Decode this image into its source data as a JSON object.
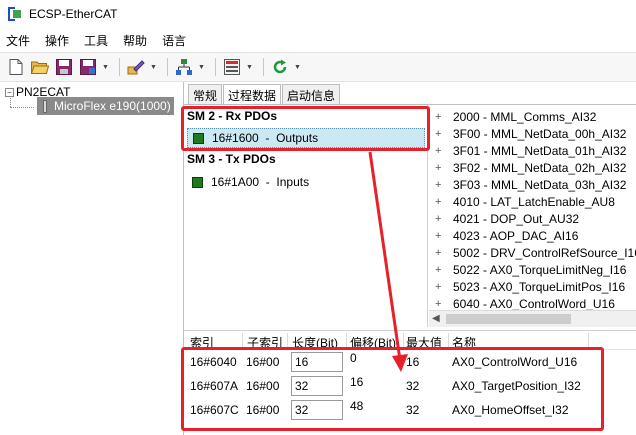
{
  "window": {
    "title": "ECSP-EtherCAT"
  },
  "menu": [
    "文件",
    "操作",
    "工具",
    "帮助",
    "语言"
  ],
  "toolbar": {
    "icons": [
      "new-file-icon",
      "open-folder-icon",
      "save-icon",
      "save-as-icon",
      "edit-icon",
      "network-icon",
      "device-config-icon",
      "refresh-icon"
    ]
  },
  "tree": {
    "root": "PN2ECAT",
    "child": "MicroFlex e190(1000)"
  },
  "tabs": [
    "常规",
    "过程数据",
    "启动信息"
  ],
  "sm2": {
    "title": "SM 2 - Rx PDOs",
    "pdo": {
      "index": "16#1600",
      "name": "Outputs"
    }
  },
  "sm3": {
    "title": "SM 3 - Tx PDOs",
    "pdo": {
      "index": "16#1A00",
      "name": "Inputs"
    }
  },
  "entries": [
    "2000 - MML_Comms_AI32",
    "3F00 - MML_NetData_00h_AI32",
    "3F01 - MML_NetData_01h_AI32",
    "3F02 - MML_NetData_02h_AI32",
    "3F03 - MML_NetData_03h_AI32",
    "4010 - LAT_LatchEnable_AU8",
    "4021 - DOP_Out_AU32",
    "4023 - AOP_DAC_AI16",
    "5002 - DRV_ControlRefSource_I16",
    "5022 - AX0_TorqueLimitNeg_I16",
    "5023 - AX0_TorqueLimitPos_I16",
    "6040 - AX0_ControlWord_U16"
  ],
  "detail": {
    "headers": [
      "索引",
      "子索引",
      "长度(Bit)",
      "偏移(Bit)",
      "最大值",
      "名称"
    ],
    "rows": [
      {
        "index": "16#6040",
        "subindex": "16#00",
        "length": "16",
        "offset": "0",
        "max": "16",
        "name": "AX0_ControlWord_U16"
      },
      {
        "index": "16#607A",
        "subindex": "16#00",
        "length": "32",
        "offset": "16",
        "max": "32",
        "name": "AX0_TargetPosition_I32"
      },
      {
        "index": "16#607C",
        "subindex": "16#00",
        "length": "32",
        "offset": "48",
        "max": "32",
        "name": "AX0_HomeOffset_I32"
      }
    ]
  },
  "colors": {
    "highlight": "#e8202a",
    "pdo_box": "#1e7a1e",
    "selection": "#cce8f3",
    "tree_selected": "#8a8a8a"
  }
}
